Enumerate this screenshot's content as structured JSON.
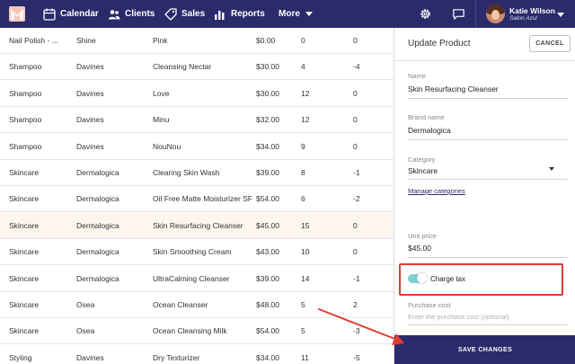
{
  "nav": {
    "calendar": "Calendar",
    "clients": "Clients",
    "sales": "Sales",
    "reports": "Reports",
    "more": "More"
  },
  "user": {
    "name": "Katie Wilson",
    "salon": "Salon Azul"
  },
  "table": {
    "rows": [
      [
        "Nail Polish - ...",
        "Shine",
        "Pink",
        "$0.00",
        "0",
        "0"
      ],
      [
        "Shampoo",
        "Davines",
        "Cleansing Nectar",
        "$30.00",
        "4",
        "-4"
      ],
      [
        "Shampoo",
        "Davines",
        "Love",
        "$30.00",
        "12",
        "0"
      ],
      [
        "Shampoo",
        "Davines",
        "Minu",
        "$32.00",
        "12",
        "0"
      ],
      [
        "Shampoo",
        "Davines",
        "NouNou",
        "$34.00",
        "9",
        "0"
      ],
      [
        "Skincare",
        "Dermalogica",
        "Clearing Skin Wash",
        "$39.00",
        "8",
        "-1"
      ],
      [
        "Skincare",
        "Dermalogica",
        "Oil Free Matte Moisturizer SF",
        "$54.00",
        "6",
        "-2"
      ],
      [
        "Skincare",
        "Dermalogica",
        "Skin Resurfacing Cleanser",
        "$45.00",
        "15",
        "0"
      ],
      [
        "Skincare",
        "Dermalogica",
        "Skin Smoothing Cream",
        "$43.00",
        "10",
        "0"
      ],
      [
        "Skincare",
        "Dermalogica",
        "UltraCalming Cleanser",
        "$39.00",
        "14",
        "-1"
      ],
      [
        "Skincare",
        "Osea",
        "Ocean Cleanser",
        "$48.00",
        "5",
        "2"
      ],
      [
        "Skincare",
        "Osea",
        "Ocean Cleansing Milk",
        "$54.00",
        "5",
        "-3"
      ],
      [
        "Styling",
        "Davines",
        "Dry Texturizer",
        "$34.00",
        "11",
        "-5"
      ]
    ]
  },
  "panel": {
    "title": "Update Product",
    "cancel": "CANCEL",
    "name_label": "Name",
    "name_value": "Skin Resurfacing Cleanser",
    "brand_label": "Brand name",
    "brand_value": "Dermalogica",
    "category_label": "Category",
    "category_value": "Skincare",
    "manage_link": "Manage categories",
    "price_label": "Unit price",
    "price_value": "$45.00",
    "charge_tax_label": "Charge tax",
    "charge_tax_on": true,
    "purchase_label": "Purchase cost",
    "purchase_placeholder": "Enter the purchase cost (optional)",
    "save": "SAVE CHANGES"
  },
  "colors": {
    "nav_bg": "#2b2a6b",
    "highlight_row": "#fdf6ef",
    "annotation_red": "#e03c2f",
    "toggle_on": "#7fd0d2"
  }
}
